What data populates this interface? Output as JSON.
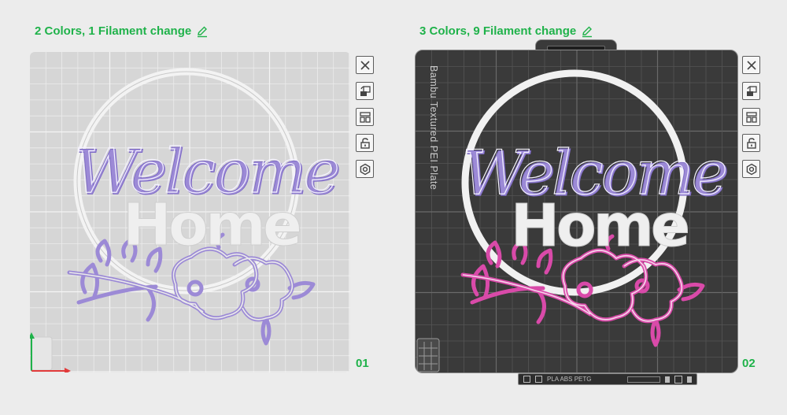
{
  "plates": [
    {
      "title": "2 Colors, 1 Filament change",
      "number": "01"
    },
    {
      "title": "3 Colors, 9 Filament change",
      "number": "02",
      "bed_label": "Bambu Textured PEI Plate",
      "bottom_strip_text": "PLA ABS PETG"
    }
  ],
  "design": {
    "word_script": "Welcome",
    "word_block": "Home"
  },
  "toolbar_icons": [
    "close-icon",
    "auto-orient-icon",
    "arrange-icon",
    "lock-icon",
    "settings-icon"
  ],
  "colors": {
    "accent": "#1fb24a",
    "bed_light": "#d6d6d6",
    "bed_dark": "#3a3a3a",
    "purple": "#9c8ad6",
    "pink": "#d94aa9",
    "white_part": "#efefef"
  }
}
